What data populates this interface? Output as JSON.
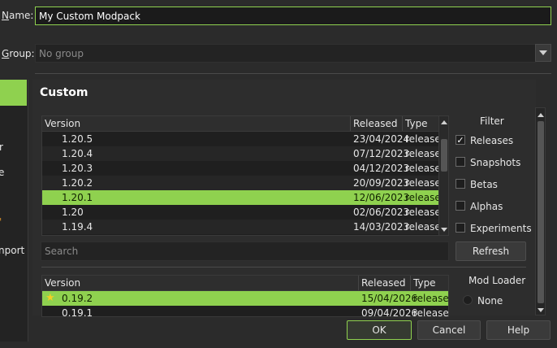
{
  "form": {
    "name_label": "Name:",
    "name_value": "My Custom Modpack",
    "group_label": "Group:",
    "group_placeholder": "No group"
  },
  "sidebar": {
    "items": [
      {
        "label": ""
      },
      {
        "label": "r"
      },
      {
        "label": "e"
      },
      {
        "label": "'"
      },
      {
        "label": "nport"
      }
    ]
  },
  "custom": {
    "heading": "Custom",
    "table_headers": [
      "Version",
      "Released",
      "Type"
    ],
    "versions": [
      {
        "version": "1.20.5",
        "released": "23/04/2024",
        "type": "release"
      },
      {
        "version": "1.20.4",
        "released": "07/12/2023",
        "type": "release"
      },
      {
        "version": "1.20.3",
        "released": "04/12/2023",
        "type": "release"
      },
      {
        "version": "1.20.2",
        "released": "20/09/2023",
        "type": "release"
      },
      {
        "version": "1.20.1",
        "released": "12/06/2023",
        "type": "release"
      },
      {
        "version": "1.20",
        "released": "02/06/2023",
        "type": "release"
      },
      {
        "version": "1.19.4",
        "released": "14/03/2023",
        "type": "release"
      }
    ],
    "selected_version": "1.20.1",
    "search_placeholder": "Search",
    "filter": {
      "title": "Filter",
      "options": [
        {
          "label": "Releases",
          "checked": true,
          "mark": "✓"
        },
        {
          "label": "Snapshots",
          "checked": false,
          "mark": ""
        },
        {
          "label": "Betas",
          "checked": false,
          "mark": ""
        },
        {
          "label": "Alphas",
          "checked": false,
          "mark": ""
        },
        {
          "label": "Experiments",
          "checked": false,
          "mark": ""
        }
      ],
      "refresh_label": "Refresh"
    }
  },
  "mod_loader": {
    "title": "Mod Loader",
    "table_headers": [
      "Version",
      "Released",
      "Type"
    ],
    "versions": [
      {
        "version": "0.19.2",
        "released": "15/04/2026",
        "type": "release",
        "recommended": true
      },
      {
        "version": "0.19.1",
        "released": "09/04/2026",
        "type": "release",
        "recommended": false
      }
    ],
    "options": [
      {
        "label": "None",
        "selected": false
      }
    ]
  },
  "buttons": {
    "ok": "OK",
    "cancel": "Cancel",
    "help": "Help"
  },
  "colors": {
    "accent": "#8fd14f",
    "background": "#2b2b2b",
    "field_background": "#1e1e1e"
  },
  "icons": {
    "dropdown": "chevron-down-icon",
    "checkbox_mark": "check-icon",
    "recommended": "star-icon"
  }
}
